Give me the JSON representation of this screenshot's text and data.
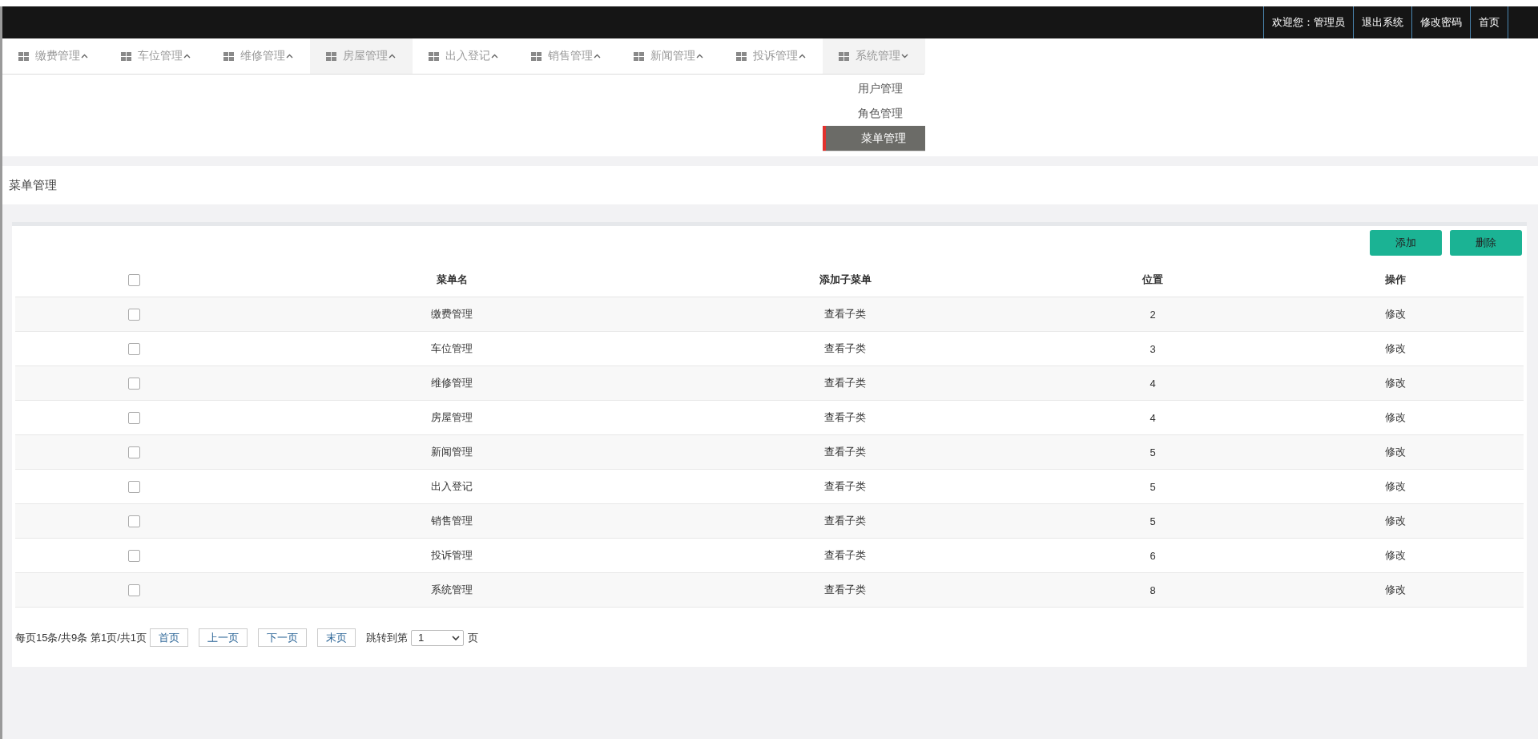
{
  "top_bar": {
    "links": [
      {
        "label": "欢迎您：管理员"
      },
      {
        "label": "退出系统"
      },
      {
        "label": "修改密码"
      },
      {
        "label": "首页"
      }
    ]
  },
  "nav": {
    "items": [
      {
        "label": "缴费管理",
        "highlighted": false,
        "expanded": false
      },
      {
        "label": "车位管理",
        "highlighted": false,
        "expanded": false
      },
      {
        "label": "维修管理",
        "highlighted": false,
        "expanded": false
      },
      {
        "label": "房屋管理",
        "highlighted": true,
        "expanded": false
      },
      {
        "label": "出入登记",
        "highlighted": false,
        "expanded": false
      },
      {
        "label": "销售管理",
        "highlighted": false,
        "expanded": false
      },
      {
        "label": "新闻管理",
        "highlighted": false,
        "expanded": false
      },
      {
        "label": "投诉管理",
        "highlighted": false,
        "expanded": false
      },
      {
        "label": "系统管理",
        "highlighted": false,
        "expanded": true,
        "submenu": [
          {
            "label": "用户管理",
            "selected": false
          },
          {
            "label": "角色管理",
            "selected": false
          },
          {
            "label": "菜单管理",
            "selected": true
          }
        ]
      }
    ]
  },
  "breadcrumb": "菜单管理",
  "toolbar": {
    "buttons": [
      "添加",
      "删除"
    ]
  },
  "table": {
    "header_checked": false,
    "columns": [
      "菜单名",
      "添加子菜单",
      "位置",
      "操作"
    ],
    "rows": [
      {
        "checked": false,
        "cells": [
          "缴费管理",
          "查看子类",
          "2",
          "修改"
        ]
      },
      {
        "checked": false,
        "cells": [
          "车位管理",
          "查看子类",
          "3",
          "修改"
        ]
      },
      {
        "checked": false,
        "cells": [
          "维修管理",
          "查看子类",
          "4",
          "修改"
        ]
      },
      {
        "checked": false,
        "cells": [
          "房屋管理",
          "查看子类",
          "4",
          "修改"
        ]
      },
      {
        "checked": false,
        "cells": [
          "新闻管理",
          "查看子类",
          "5",
          "修改"
        ]
      },
      {
        "checked": false,
        "cells": [
          "出入登记",
          "查看子类",
          "5",
          "修改"
        ]
      },
      {
        "checked": false,
        "cells": [
          "销售管理",
          "查看子类",
          "5",
          "修改"
        ]
      },
      {
        "checked": false,
        "cells": [
          "投诉管理",
          "查看子类",
          "6",
          "修改"
        ]
      },
      {
        "checked": false,
        "cells": [
          "系统管理",
          "查看子类",
          "8",
          "修改"
        ]
      }
    ]
  },
  "pagination": {
    "summary": "每页15条/共9条 第1页/共1页",
    "buttons": [
      "首页",
      "上一页",
      "下一页",
      "末页"
    ],
    "jump_label": "跳转到第",
    "page_value": "1",
    "suffix": "页"
  }
}
